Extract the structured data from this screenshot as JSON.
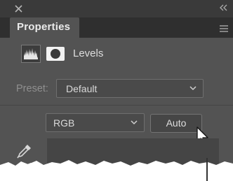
{
  "window": {
    "close_icon": "close-icon",
    "collapse_icon": "double-chevron-left-icon"
  },
  "panel": {
    "tab_label": "Properties",
    "menu_icon": "panel-menu-icon"
  },
  "adjustment": {
    "type_icon": "levels-histogram-icon",
    "mask_icon": "layer-mask-icon",
    "title": "Levels"
  },
  "preset": {
    "label": "Preset:",
    "value": "Default"
  },
  "channel": {
    "value": "RGB"
  },
  "auto_button": {
    "label": "Auto"
  },
  "tools": {
    "eyedropper_icon": "eyedropper-icon"
  },
  "colors": {
    "panel_bg": "#535353",
    "tab_strip_bg": "#2f2f2f",
    "title_bar_bg": "#3a3a3a",
    "control_bg": "#4a4a4a",
    "text": "#dcdcdc",
    "muted_text": "#8f8f8f"
  }
}
